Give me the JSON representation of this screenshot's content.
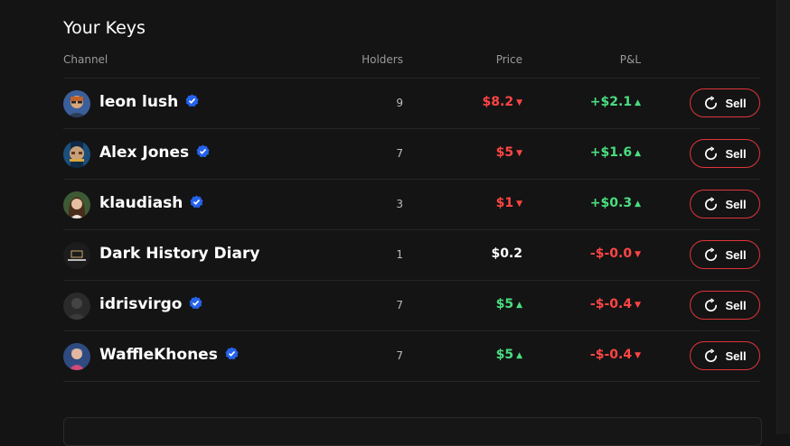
{
  "section_title": "Your Keys",
  "columns": {
    "channel": "Channel",
    "holders": "Holders",
    "price": "Price",
    "pnl": "P&L"
  },
  "sell_label": "Sell",
  "rows": [
    {
      "name": "leon lush",
      "verified": true,
      "holders": "9",
      "price": "$8.2",
      "price_dir": "down",
      "pnl": "+$2.1",
      "pnl_dir": "up"
    },
    {
      "name": "Alex Jones",
      "verified": true,
      "holders": "7",
      "price": "$5",
      "price_dir": "down",
      "pnl": "+$1.6",
      "pnl_dir": "up"
    },
    {
      "name": "klaudiash",
      "verified": true,
      "holders": "3",
      "price": "$1",
      "price_dir": "down",
      "pnl": "+$0.3",
      "pnl_dir": "up"
    },
    {
      "name": "Dark History Diary",
      "verified": false,
      "holders": "1",
      "price": "$0.2",
      "price_dir": "none",
      "pnl": "-$-0.0",
      "pnl_dir": "down"
    },
    {
      "name": "idrisvirgo",
      "verified": true,
      "holders": "7",
      "price": "$5",
      "price_dir": "up",
      "pnl": "-$-0.4",
      "pnl_dir": "down"
    },
    {
      "name": "WaffleKhones",
      "verified": true,
      "holders": "7",
      "price": "$5",
      "price_dir": "up",
      "pnl": "-$-0.4",
      "pnl_dir": "down"
    }
  ],
  "colors": {
    "down": "#ff4545",
    "up": "#4ade80",
    "neutral": "#ffffff",
    "sell_border": "#e0353b",
    "verified": "#2563eb"
  }
}
